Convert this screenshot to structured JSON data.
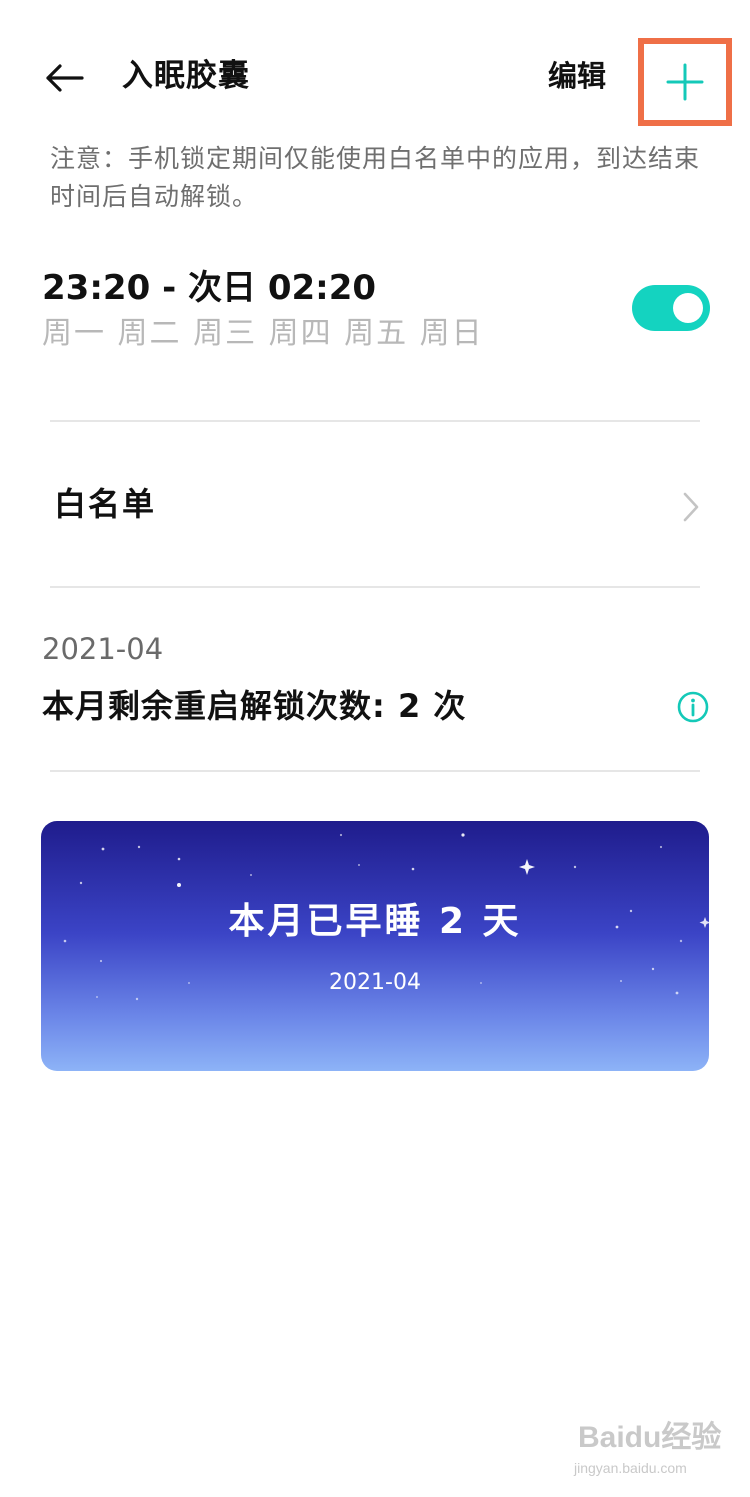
{
  "header": {
    "title": "入眠胶囊",
    "edit_label": "编辑"
  },
  "notice": "注意：手机锁定期间仅能使用白名单中的应用，到达结束时间后自动解锁。",
  "schedule": {
    "time_range": "23:20 - 次日 02:20",
    "days": "周一 周二 周三 周四 周五 周日",
    "enabled": true
  },
  "whitelist": {
    "label": "白名单"
  },
  "unlock": {
    "month": "2021-04",
    "remaining_text": "本月剩余重启解锁次数: 2 次"
  },
  "sleep_card": {
    "title": "本月已早睡 2 天",
    "subtitle": "2021-04"
  },
  "watermark": {
    "brand": "Baidu经验",
    "url": "jingyan.baidu.com"
  },
  "colors": {
    "accent": "#14d3c0",
    "highlight_box": "#ef6f47",
    "card_top": "#1f1c8c",
    "card_bottom": "#8db3f7"
  },
  "icons": {
    "back": "arrow-left-icon",
    "add": "plus-icon",
    "chevron": "chevron-right-icon",
    "info": "info-icon"
  }
}
